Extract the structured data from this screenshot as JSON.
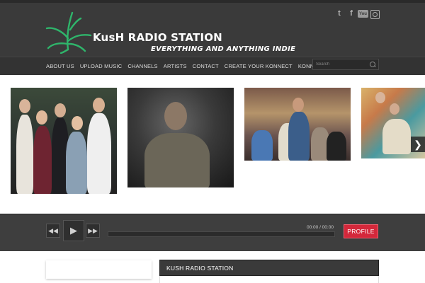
{
  "header": {
    "title": "KusH RADIO STATION",
    "tagline": "EVERYTHING AND ANYTHING INDIE",
    "logo_icon": "cannabis-leaf-icon",
    "brand_color": "#2fb56b",
    "social": [
      {
        "name": "twitter-icon",
        "glyph": "t"
      },
      {
        "name": "facebook-icon",
        "glyph": "f"
      },
      {
        "name": "youtube-icon",
        "glyph": "You"
      },
      {
        "name": "instagram-icon",
        "glyph": ""
      }
    ]
  },
  "nav": {
    "items": [
      "ABOUT US",
      "UPLOAD MUSIC",
      "CHANNELS",
      "ARTISTS",
      "CONTACT",
      "CREATE YOUR KONNECT",
      "KONNECT"
    ],
    "search_placeholder": "Search"
  },
  "slider": {
    "next_glyph": "❯"
  },
  "player": {
    "rewind_glyph": "◀◀",
    "play_glyph": "▶",
    "forward_glyph": "▶▶",
    "time": "00:00 / 00:00",
    "progress": 0,
    "profile_label": "PROFILE",
    "accent": "#d4283b"
  },
  "main": {
    "widget_title": "KUSH RADIO STATION"
  }
}
